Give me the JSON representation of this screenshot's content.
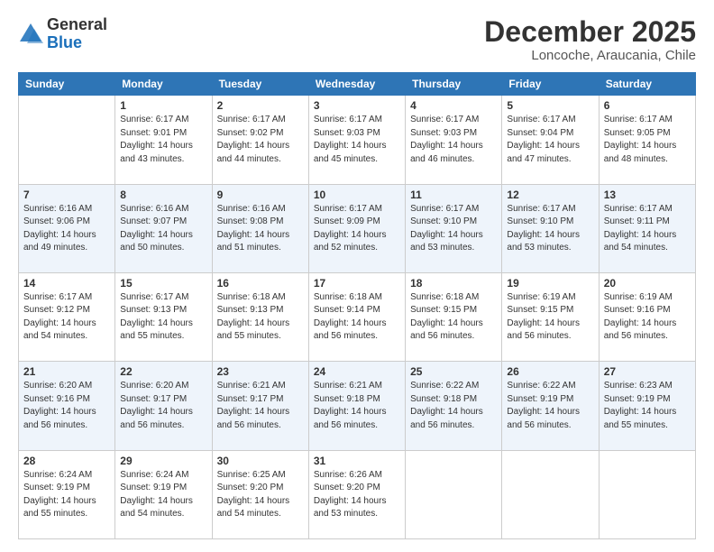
{
  "header": {
    "logo_general": "General",
    "logo_blue": "Blue",
    "month_title": "December 2025",
    "subtitle": "Loncoche, Araucania, Chile"
  },
  "days_of_week": [
    "Sunday",
    "Monday",
    "Tuesday",
    "Wednesday",
    "Thursday",
    "Friday",
    "Saturday"
  ],
  "weeks": [
    {
      "row_style": "normal-row",
      "days": [
        {
          "num": "",
          "info": ""
        },
        {
          "num": "1",
          "info": "Sunrise: 6:17 AM\nSunset: 9:01 PM\nDaylight: 14 hours\nand 43 minutes."
        },
        {
          "num": "2",
          "info": "Sunrise: 6:17 AM\nSunset: 9:02 PM\nDaylight: 14 hours\nand 44 minutes."
        },
        {
          "num": "3",
          "info": "Sunrise: 6:17 AM\nSunset: 9:03 PM\nDaylight: 14 hours\nand 45 minutes."
        },
        {
          "num": "4",
          "info": "Sunrise: 6:17 AM\nSunset: 9:03 PM\nDaylight: 14 hours\nand 46 minutes."
        },
        {
          "num": "5",
          "info": "Sunrise: 6:17 AM\nSunset: 9:04 PM\nDaylight: 14 hours\nand 47 minutes."
        },
        {
          "num": "6",
          "info": "Sunrise: 6:17 AM\nSunset: 9:05 PM\nDaylight: 14 hours\nand 48 minutes."
        }
      ]
    },
    {
      "row_style": "alt-row",
      "days": [
        {
          "num": "7",
          "info": "Sunrise: 6:16 AM\nSunset: 9:06 PM\nDaylight: 14 hours\nand 49 minutes."
        },
        {
          "num": "8",
          "info": "Sunrise: 6:16 AM\nSunset: 9:07 PM\nDaylight: 14 hours\nand 50 minutes."
        },
        {
          "num": "9",
          "info": "Sunrise: 6:16 AM\nSunset: 9:08 PM\nDaylight: 14 hours\nand 51 minutes."
        },
        {
          "num": "10",
          "info": "Sunrise: 6:17 AM\nSunset: 9:09 PM\nDaylight: 14 hours\nand 52 minutes."
        },
        {
          "num": "11",
          "info": "Sunrise: 6:17 AM\nSunset: 9:10 PM\nDaylight: 14 hours\nand 53 minutes."
        },
        {
          "num": "12",
          "info": "Sunrise: 6:17 AM\nSunset: 9:10 PM\nDaylight: 14 hours\nand 53 minutes."
        },
        {
          "num": "13",
          "info": "Sunrise: 6:17 AM\nSunset: 9:11 PM\nDaylight: 14 hours\nand 54 minutes."
        }
      ]
    },
    {
      "row_style": "normal-row",
      "days": [
        {
          "num": "14",
          "info": "Sunrise: 6:17 AM\nSunset: 9:12 PM\nDaylight: 14 hours\nand 54 minutes."
        },
        {
          "num": "15",
          "info": "Sunrise: 6:17 AM\nSunset: 9:13 PM\nDaylight: 14 hours\nand 55 minutes."
        },
        {
          "num": "16",
          "info": "Sunrise: 6:18 AM\nSunset: 9:13 PM\nDaylight: 14 hours\nand 55 minutes."
        },
        {
          "num": "17",
          "info": "Sunrise: 6:18 AM\nSunset: 9:14 PM\nDaylight: 14 hours\nand 56 minutes."
        },
        {
          "num": "18",
          "info": "Sunrise: 6:18 AM\nSunset: 9:15 PM\nDaylight: 14 hours\nand 56 minutes."
        },
        {
          "num": "19",
          "info": "Sunrise: 6:19 AM\nSunset: 9:15 PM\nDaylight: 14 hours\nand 56 minutes."
        },
        {
          "num": "20",
          "info": "Sunrise: 6:19 AM\nSunset: 9:16 PM\nDaylight: 14 hours\nand 56 minutes."
        }
      ]
    },
    {
      "row_style": "alt-row",
      "days": [
        {
          "num": "21",
          "info": "Sunrise: 6:20 AM\nSunset: 9:16 PM\nDaylight: 14 hours\nand 56 minutes."
        },
        {
          "num": "22",
          "info": "Sunrise: 6:20 AM\nSunset: 9:17 PM\nDaylight: 14 hours\nand 56 minutes."
        },
        {
          "num": "23",
          "info": "Sunrise: 6:21 AM\nSunset: 9:17 PM\nDaylight: 14 hours\nand 56 minutes."
        },
        {
          "num": "24",
          "info": "Sunrise: 6:21 AM\nSunset: 9:18 PM\nDaylight: 14 hours\nand 56 minutes."
        },
        {
          "num": "25",
          "info": "Sunrise: 6:22 AM\nSunset: 9:18 PM\nDaylight: 14 hours\nand 56 minutes."
        },
        {
          "num": "26",
          "info": "Sunrise: 6:22 AM\nSunset: 9:19 PM\nDaylight: 14 hours\nand 56 minutes."
        },
        {
          "num": "27",
          "info": "Sunrise: 6:23 AM\nSunset: 9:19 PM\nDaylight: 14 hours\nand 55 minutes."
        }
      ]
    },
    {
      "row_style": "normal-row",
      "days": [
        {
          "num": "28",
          "info": "Sunrise: 6:24 AM\nSunset: 9:19 PM\nDaylight: 14 hours\nand 55 minutes."
        },
        {
          "num": "29",
          "info": "Sunrise: 6:24 AM\nSunset: 9:19 PM\nDaylight: 14 hours\nand 54 minutes."
        },
        {
          "num": "30",
          "info": "Sunrise: 6:25 AM\nSunset: 9:20 PM\nDaylight: 14 hours\nand 54 minutes."
        },
        {
          "num": "31",
          "info": "Sunrise: 6:26 AM\nSunset: 9:20 PM\nDaylight: 14 hours\nand 53 minutes."
        },
        {
          "num": "",
          "info": ""
        },
        {
          "num": "",
          "info": ""
        },
        {
          "num": "",
          "info": ""
        }
      ]
    }
  ]
}
